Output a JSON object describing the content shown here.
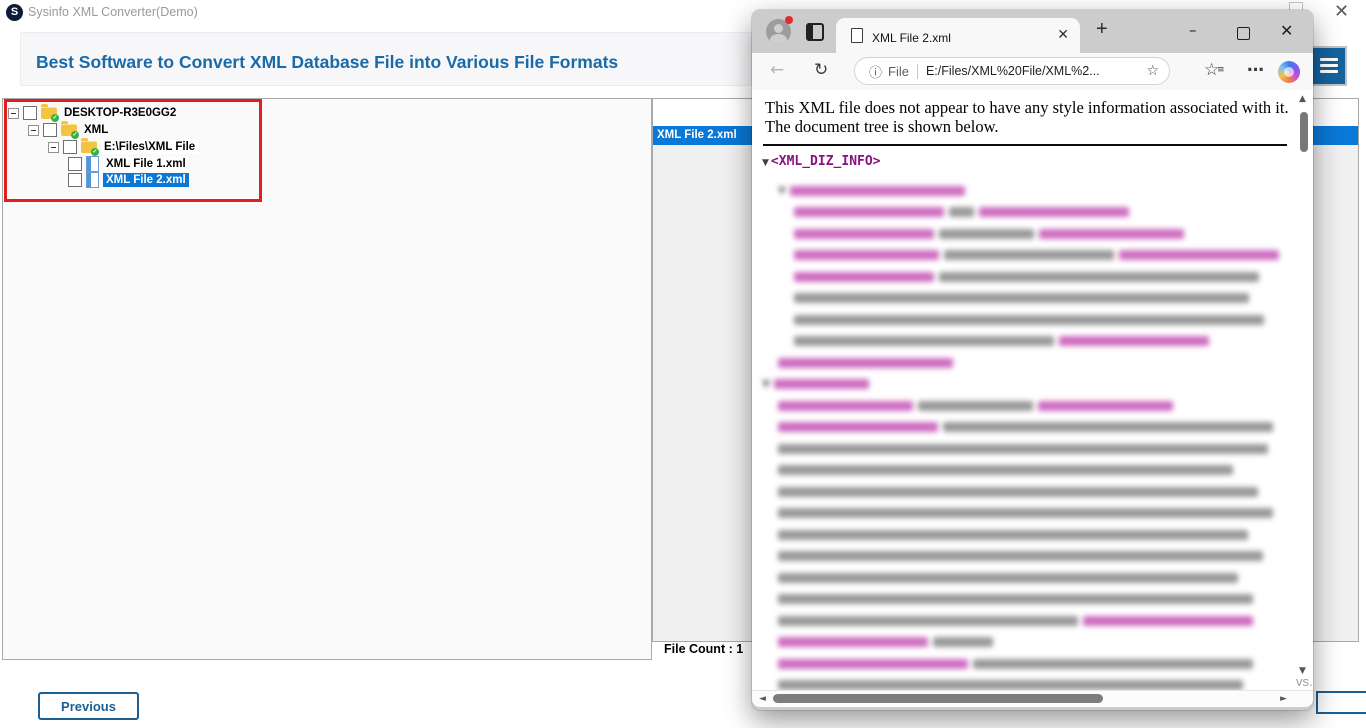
{
  "colors": {
    "selection_blue": "#0a78d7",
    "header_blue": "#1a6aa8",
    "button_blue": "#1c5f93",
    "highlight_red": "#e01f1f",
    "xml_tag_purple": "#881280"
  },
  "app": {
    "title": "Sysinfo XML Converter(Demo)",
    "logo_letter": "S",
    "header_title": "Best Software to Convert XML Database File into Various File Formats",
    "close_glyph": "✕",
    "tree": {
      "items": [
        {
          "label": "DESKTOP-R3E0GG2",
          "indent": 0,
          "icon": "folder",
          "expander": true,
          "highlight": "none",
          "checked": false
        },
        {
          "label": "XML",
          "indent": 1,
          "icon": "folder",
          "expander": true,
          "highlight": "none",
          "checked": false
        },
        {
          "label": "E:\\Files\\XML File",
          "indent": 2,
          "icon": "folder",
          "expander": true,
          "highlight": "white",
          "checked": false
        },
        {
          "label": "XML File 1.xml",
          "indent": 3,
          "icon": "xml",
          "expander": false,
          "highlight": "white",
          "checked": false
        },
        {
          "label": "XML File 2.xml",
          "indent": 3,
          "icon": "xml",
          "expander": false,
          "highlight": "blue",
          "checked": false
        }
      ]
    },
    "file_list": {
      "selected_item": "XML File 2.xml"
    },
    "file_count_label": "File Count : 1",
    "previous_button_label": "Previous",
    "partial_text": "vs."
  },
  "browser": {
    "tab_title": "XML File 2.xml",
    "tab_close_glyph": "✕",
    "new_tab_glyph": "+",
    "minimize_glyph": "–",
    "close_glyph": "✕",
    "back_glyph": "←",
    "refresh_glyph": "↻",
    "info_glyph": "ⓘ",
    "url_scheme_label": "File",
    "url_value": "E:/Files/XML%20File/XML%2...",
    "url_star_glyph": "☆",
    "favorites_glyph": "☆",
    "favorites_lines_glyph": "≡",
    "menu_dots_glyph": "…",
    "scroll_up_glyph": "▲",
    "scroll_down_glyph": "▼",
    "scroll_left_glyph": "◄",
    "scroll_right_glyph": "►",
    "notice_line1": "This XML file does not appear to have any style information associated with it.",
    "notice_line2": "The document tree is shown below.",
    "xml_root_arrow": "▼",
    "xml_root_tag": "<XML_DIZ_INFO>",
    "xml_blurred_lines": [
      {
        "i": 1,
        "a": true,
        "s": [
          [
            "tag",
            175
          ]
        ]
      },
      {
        "i": 2,
        "a": false,
        "s": [
          [
            "tag",
            150
          ],
          [
            "txt",
            25
          ],
          [
            "tag",
            150
          ]
        ]
      },
      {
        "i": 2,
        "a": false,
        "s": [
          [
            "tag",
            140
          ],
          [
            "txt",
            95
          ],
          [
            "tag",
            145
          ]
        ]
      },
      {
        "i": 2,
        "a": false,
        "s": [
          [
            "tag",
            145
          ],
          [
            "txt",
            170
          ],
          [
            "tag",
            160
          ]
        ]
      },
      {
        "i": 2,
        "a": false,
        "s": [
          [
            "tag",
            140
          ],
          [
            "txt",
            320
          ]
        ]
      },
      {
        "i": 2,
        "a": false,
        "s": [
          [
            "txt",
            455
          ]
        ]
      },
      {
        "i": 2,
        "a": false,
        "s": [
          [
            "txt",
            470
          ]
        ]
      },
      {
        "i": 2,
        "a": false,
        "s": [
          [
            "txt",
            260
          ],
          [
            "tag",
            150
          ]
        ]
      },
      {
        "i": 1,
        "a": false,
        "s": [
          [
            "tag",
            175
          ]
        ]
      },
      {
        "i": 0,
        "a": true,
        "s": [
          [
            "tag",
            95
          ]
        ]
      },
      {
        "i": 1,
        "a": false,
        "s": [
          [
            "tag",
            135
          ],
          [
            "txt",
            115
          ],
          [
            "tag",
            135
          ]
        ]
      },
      {
        "i": 1,
        "a": false,
        "s": [
          [
            "tag",
            160
          ],
          [
            "txt",
            330
          ]
        ]
      },
      {
        "i": 1,
        "a": false,
        "s": [
          [
            "txt",
            490
          ]
        ]
      },
      {
        "i": 1,
        "a": false,
        "s": [
          [
            "txt",
            455
          ]
        ]
      },
      {
        "i": 1,
        "a": false,
        "s": [
          [
            "txt",
            480
          ]
        ]
      },
      {
        "i": 1,
        "a": false,
        "s": [
          [
            "txt",
            495
          ]
        ]
      },
      {
        "i": 1,
        "a": false,
        "s": [
          [
            "txt",
            470
          ]
        ]
      },
      {
        "i": 1,
        "a": false,
        "s": [
          [
            "txt",
            485
          ]
        ]
      },
      {
        "i": 1,
        "a": false,
        "s": [
          [
            "txt",
            460
          ]
        ]
      },
      {
        "i": 1,
        "a": false,
        "s": [
          [
            "txt",
            475
          ]
        ]
      },
      {
        "i": 1,
        "a": false,
        "s": [
          [
            "txt",
            300
          ],
          [
            "tag",
            170
          ]
        ]
      },
      {
        "i": 1,
        "a": false,
        "s": [
          [
            "tag",
            150
          ],
          [
            "txt",
            60
          ]
        ]
      },
      {
        "i": 1,
        "a": false,
        "s": [
          [
            "tag",
            190
          ],
          [
            "txt",
            280
          ]
        ]
      },
      {
        "i": 1,
        "a": false,
        "s": [
          [
            "txt",
            465
          ]
        ]
      }
    ]
  }
}
